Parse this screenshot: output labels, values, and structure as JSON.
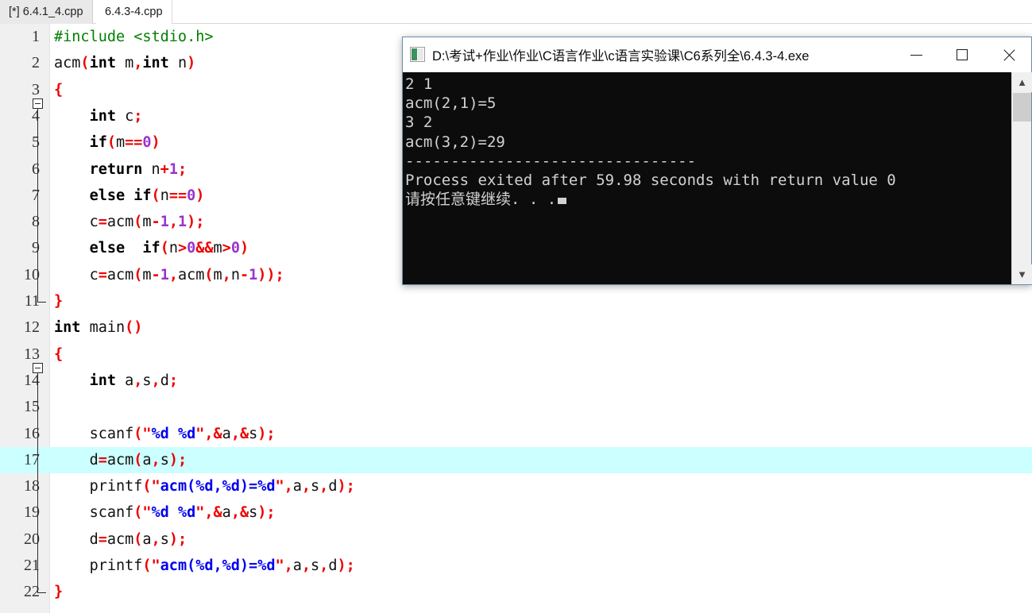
{
  "tabs": [
    {
      "label": "[*] 6.4.1_4.cpp",
      "active": false
    },
    {
      "label": "6.4.3-4.cpp",
      "active": true
    }
  ],
  "editor": {
    "current_line": 17,
    "fold_markers": [
      3,
      13
    ],
    "highlight_color": "#ccffff",
    "gutter_color": "#f0f0f0",
    "lines": [
      {
        "n": "1",
        "text": "#include <stdio.h>"
      },
      {
        "n": "2",
        "text": "acm(int m,int n)"
      },
      {
        "n": "3",
        "text": "{"
      },
      {
        "n": "4",
        "text": "    int c;"
      },
      {
        "n": "5",
        "text": "    if(m==0)"
      },
      {
        "n": "6",
        "text": "    return n+1;"
      },
      {
        "n": "7",
        "text": "    else if(n==0)"
      },
      {
        "n": "8",
        "text": "    c=acm(m-1,1);"
      },
      {
        "n": "9",
        "text": "    else  if(n>0&&m>0)"
      },
      {
        "n": "10",
        "text": "    c=acm(m-1,acm(m,n-1));"
      },
      {
        "n": "11",
        "text": "}"
      },
      {
        "n": "12",
        "text": "int main()"
      },
      {
        "n": "13",
        "text": "{"
      },
      {
        "n": "14",
        "text": "    int a,s,d;"
      },
      {
        "n": "15",
        "text": ""
      },
      {
        "n": "16",
        "text": "    scanf(\"%d %d\",&a,&s);"
      },
      {
        "n": "17",
        "text": "    d=acm(a,s);"
      },
      {
        "n": "18",
        "text": "    printf(\"acm(%d,%d)=%d\",a,s,d);"
      },
      {
        "n": "19",
        "text": "    scanf(\"%d %d\",&a,&s);"
      },
      {
        "n": "20",
        "text": "    d=acm(a,s);"
      },
      {
        "n": "21",
        "text": "    printf(\"acm(%d,%d)=%d\",a,s,d);"
      },
      {
        "n": "22",
        "text": "}"
      }
    ]
  },
  "console": {
    "title": "D:\\考试+作业\\作业\\C语言作业\\c语言实验课\\C6系列全\\6.4.3-4.exe",
    "icon": "console-icon",
    "buttons": {
      "minimize": "minimize-icon",
      "maximize": "maximize-icon",
      "close": "close-icon"
    },
    "output": "2 1\nacm(2,1)=5\n3 2\nacm(3,2)=29\n--------------------------------\nProcess exited after 59.98 seconds with return value 0\n请按任意键继续. . .",
    "background": "#0c0c0c",
    "text_color": "#d2d2d2",
    "scrollbar": {
      "up": "▲",
      "down": "▼"
    }
  }
}
